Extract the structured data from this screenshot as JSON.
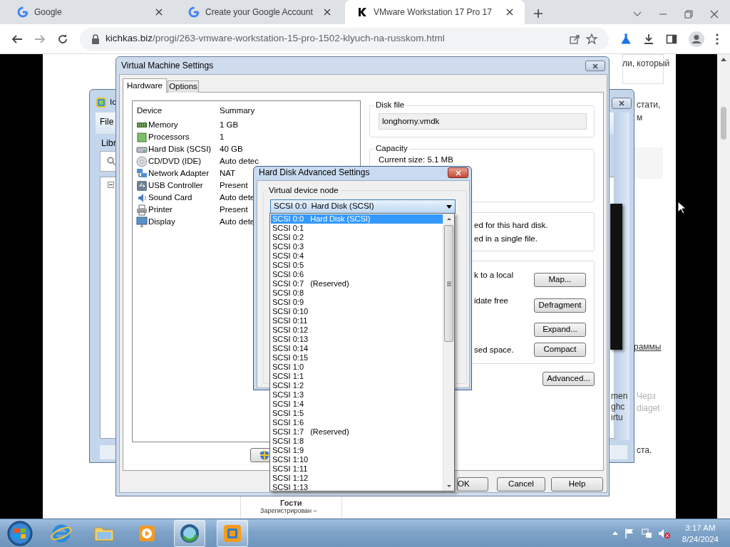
{
  "browser": {
    "tabs": [
      {
        "title": "Google",
        "selected": false
      },
      {
        "title": "Create your Google Account",
        "selected": false
      },
      {
        "title": "VMware Workstation 17 Pro 17",
        "selected": true
      }
    ],
    "url_host": "kichkas.biz",
    "url_path": "/progi/263-vmware-workstation-15-pro-1502-klyuch-na-russkom.html"
  },
  "page_fragments": [
    {
      "text": "ли, который",
      "kind": "text"
    },
    {
      "text": "стати,",
      "kind": "text"
    },
    {
      "text": "м",
      "kind": "text"
    },
    {
      "text": "раммы",
      "kind": "link"
    },
    {
      "text": "men",
      "kind": "text"
    },
    {
      "text": "ghc",
      "kind": "text"
    },
    {
      "text": "irtu",
      "kind": "text"
    },
    {
      "text": "Черз",
      "kind": "muted"
    },
    {
      "text": "diaget",
      "kind": "muted"
    },
    {
      "text": "ста.",
      "kind": "text"
    },
    {
      "text": "Гости",
      "kind": "heading"
    },
    {
      "text": "Зарегистрирован –",
      "kind": "small"
    }
  ],
  "workstation_window": {
    "title": "Ic",
    "menu": "File",
    "library_label": "Libr"
  },
  "vm_settings": {
    "title": "Virtual Machine Settings",
    "tabs": [
      {
        "label": "Hardware",
        "selected": true
      },
      {
        "label": "Options",
        "selected": false
      }
    ],
    "device_columns": [
      "Device",
      "Summary"
    ],
    "devices": [
      {
        "name": "Memory",
        "summary": "1 GB",
        "kind": "memory"
      },
      {
        "name": "Processors",
        "summary": "1",
        "kind": "processor"
      },
      {
        "name": "Hard Disk (SCSI)",
        "summary": "40 GB",
        "kind": "disk"
      },
      {
        "name": "CD/DVD (IDE)",
        "summary": "Auto detec",
        "kind": "cd"
      },
      {
        "name": "Network Adapter",
        "summary": "NAT",
        "kind": "network"
      },
      {
        "name": "USB Controller",
        "summary": "Present",
        "kind": "usb"
      },
      {
        "name": "Sound Card",
        "summary": "Auto dete",
        "kind": "sound"
      },
      {
        "name": "Printer",
        "summary": "Present",
        "kind": "printer"
      },
      {
        "name": "Display",
        "summary": "Auto dete",
        "kind": "display"
      }
    ],
    "disk_file_label": "Disk file",
    "disk_file": "longhorny.vmdk",
    "capacity_label": "Capacity",
    "current_size": "Current size: 5.1 MB",
    "info_lines": [
      "ed for this hard disk.",
      "ed in a single file."
    ],
    "utilities": [
      {
        "text": "k to a local",
        "button": "Map..."
      },
      {
        "text": "idate free",
        "button": "Defragment"
      },
      {
        "button": "Expand..."
      },
      {
        "text": "sed space.",
        "button": "Compact"
      }
    ],
    "advanced_button": "Advanced...",
    "buttons": [
      "OK",
      "Cancel",
      "Help"
    ]
  },
  "advanced_dialog": {
    "title": "Hard Disk Advanced Settings",
    "group_label": "Virtual device node",
    "combo_value": "SCSI 0:0  Hard Disk (SCSI)",
    "nodes": [
      {
        "node": "SCSI 0:0",
        "note": "Hard Disk (SCSI)",
        "selected": true
      },
      {
        "node": "SCSI 0:1",
        "selected": false
      },
      {
        "node": "SCSI 0:2",
        "selected": false
      },
      {
        "node": "SCSI 0:3",
        "selected": false
      },
      {
        "node": "SCSI 0:4",
        "selected": false
      },
      {
        "node": "SCSI 0:5",
        "selected": false
      },
      {
        "node": "SCSI 0:6",
        "selected": false
      },
      {
        "node": "SCSI 0:7",
        "note": "(Reserved)",
        "selected": false
      },
      {
        "node": "SCSI 0:8",
        "selected": false
      },
      {
        "node": "SCSI 0:9",
        "selected": false
      },
      {
        "node": "SCSI 0:10",
        "selected": false
      },
      {
        "node": "SCSI 0:11",
        "selected": false
      },
      {
        "node": "SCSI 0:12",
        "selected": false
      },
      {
        "node": "SCSI 0:13",
        "selected": false
      },
      {
        "node": "SCSI 0:14",
        "selected": false
      },
      {
        "node": "SCSI 0:15",
        "selected": false
      },
      {
        "node": "SCSI 1:0",
        "selected": false
      },
      {
        "node": "SCSI 1:1",
        "selected": false
      },
      {
        "node": "SCSI 1:2",
        "selected": false
      },
      {
        "node": "SCSI 1:3",
        "selected": false
      },
      {
        "node": "SCSI 1:4",
        "selected": false
      },
      {
        "node": "SCSI 1:5",
        "selected": false
      },
      {
        "node": "SCSI 1:6",
        "selected": false
      },
      {
        "node": "SCSI 1:7",
        "note": "(Reserved)",
        "selected": false
      },
      {
        "node": "SCSI 1:8",
        "selected": false
      },
      {
        "node": "SCSI 1:9",
        "selected": false
      },
      {
        "node": "SCSI 1:10",
        "selected": false
      },
      {
        "node": "SCSI 1:11",
        "selected": false
      },
      {
        "node": "SCSI 1:12",
        "selected": false
      },
      {
        "node": "SCSI 1:13",
        "selected": false
      }
    ]
  },
  "taskbar": {
    "apps": [
      {
        "kind": "ie",
        "open": false
      },
      {
        "kind": "explorer",
        "open": false
      },
      {
        "kind": "media",
        "open": false
      },
      {
        "kind": "orb",
        "open": true
      },
      {
        "kind": "vmware",
        "open": true
      }
    ],
    "time": "3:17 AM",
    "date": "8/24/2024"
  }
}
